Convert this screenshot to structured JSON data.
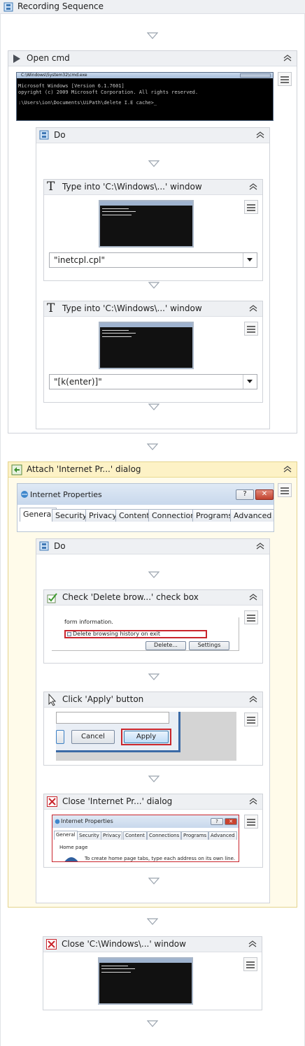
{
  "sequence": {
    "title": "Recording Sequence"
  },
  "open_cmd": {
    "title": "Open cmd",
    "cmd_title": "C:\\Windows\\System32\\cmd.exe",
    "lines": [
      "Microsoft Windows [Version 6.1.7601]",
      "opyright (c) 2009 Microsoft Corporation.  All rights reserved.",
      ":\\Users\\ion\\Documents\\UiPath\\delete I.E cache>_"
    ]
  },
  "do1": {
    "title": "Do"
  },
  "type1": {
    "title": "Type into 'C:\\Windows\\...' window",
    "value": "\"inetcpl.cpl\""
  },
  "type2": {
    "title": "Type into 'C:\\Windows\\...' window",
    "value": "\"[k(enter)]\""
  },
  "attach": {
    "title": "Attach 'Internet Pr...' dialog",
    "dialog_title": "Internet Properties",
    "help": "?",
    "close": "✕",
    "tabs": [
      "General",
      "Security",
      "Privacy",
      "Content",
      "Connections",
      "Programs",
      "Advanced"
    ]
  },
  "do2": {
    "title": "Do"
  },
  "check": {
    "title": "Check 'Delete brow...' check box",
    "form_text": "form information.",
    "checkbox_label": "Delete browsing history on exit",
    "delete_btn": "Delete...",
    "settings_btn": "Settings"
  },
  "click": {
    "title": "Click 'Apply' button",
    "cancel": "Cancel",
    "apply": "Apply"
  },
  "close_ie": {
    "title": "Close 'Internet Pr...' dialog",
    "dialog_title": "Internet Properties",
    "help": "?",
    "close": "✕",
    "tabs": [
      "General",
      "Security",
      "Privacy",
      "Content",
      "Connections",
      "Programs",
      "Advanced"
    ],
    "home_page": "Home page",
    "home_text": "To create home page tabs, type each address on its own line."
  },
  "close_cmd": {
    "title": "Close 'C:\\Windows\\...' window"
  },
  "icons": [
    "sequence-icon",
    "play-icon",
    "do-icon",
    "type-icon",
    "attach-icon",
    "check-icon",
    "click-icon",
    "close-icon",
    "collapse-icon",
    "menu-icon",
    "dropdown-icon",
    "arrow-down-icon"
  ]
}
